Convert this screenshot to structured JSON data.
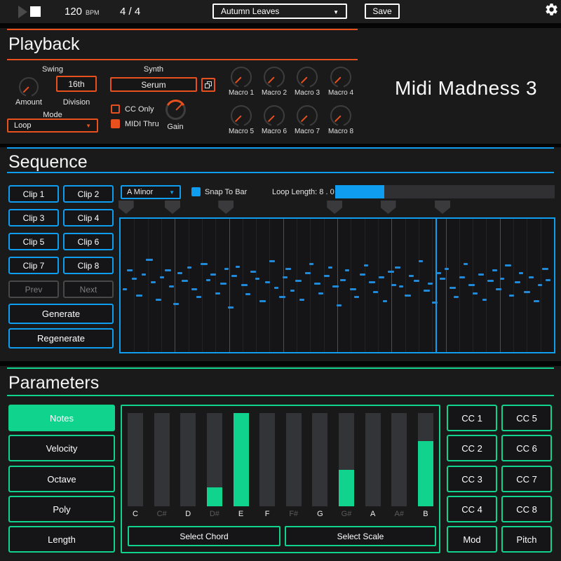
{
  "colors": {
    "orange": "#e8511e",
    "blue": "#0f9df0",
    "green": "#10d48e",
    "note_blue": "#2089d8"
  },
  "topbar": {
    "bpm_value": "120",
    "bpm_unit": "BPM",
    "time_signature": "4 / 4",
    "preset_value": "Autumn Leaves",
    "save_label": "Save"
  },
  "playback": {
    "title": "Playback",
    "swing_label": "Swing",
    "amount_label": "Amount",
    "division_value": "16th",
    "division_label": "Division",
    "synth_label": "Synth",
    "synth_value": "Serum",
    "cc_only_label": "CC Only",
    "midi_thru_label": "MIDI Thru",
    "gain_label": "Gain",
    "mode_label": "Mode",
    "mode_value": "Loop",
    "logo": "Midi Madness 3",
    "macros": [
      "Macro 1",
      "Macro 2",
      "Macro 3",
      "Macro 4",
      "Macro 5",
      "Macro 6",
      "Macro 7",
      "Macro 8"
    ]
  },
  "sequence": {
    "title": "Sequence",
    "clips": [
      "Clip 1",
      "Clip 2",
      "Clip 3",
      "Clip 4",
      "Clip 5",
      "Clip 6",
      "Clip 7",
      "Clip 8"
    ],
    "prev_label": "Prev",
    "next_label": "Next",
    "generate_label": "Generate",
    "regenerate_label": "Regenerate",
    "key_value": "A Minor",
    "snap_label": "Snap To Bar",
    "loop_length_label": "Loop Length: 8 . 0",
    "loop_fill_pct": 22.4,
    "bars": 8,
    "beats_per_bar": 4,
    "marker_positions_pct": [
      1.4,
      12.1,
      24.4,
      49.4,
      61.7,
      74.2
    ],
    "playhead_pct": 72.6,
    "notes": [
      [
        0.5,
        52,
        6
      ],
      [
        1.5,
        38,
        8
      ],
      [
        2.6,
        44,
        7
      ],
      [
        3.6,
        57,
        9
      ],
      [
        4.8,
        41,
        6
      ],
      [
        5.9,
        30,
        10
      ],
      [
        6.9,
        47,
        7
      ],
      [
        8.1,
        60,
        8
      ],
      [
        9.1,
        43,
        6
      ],
      [
        10.2,
        38,
        9
      ],
      [
        11.2,
        50,
        7
      ],
      [
        12.2,
        63,
        8
      ],
      [
        13.1,
        40,
        7
      ],
      [
        14.1,
        46,
        9
      ],
      [
        15.3,
        36,
        6
      ],
      [
        16.3,
        52,
        8
      ],
      [
        17.5,
        58,
        7
      ],
      [
        18.5,
        33,
        10
      ],
      [
        19.7,
        45,
        6
      ],
      [
        20.7,
        41,
        8
      ],
      [
        21.9,
        55,
        7
      ],
      [
        22.9,
        48,
        9
      ],
      [
        23.9,
        37,
        6
      ],
      [
        24.7,
        66,
        8
      ],
      [
        25.6,
        42,
        8
      ],
      [
        26.6,
        35,
        6
      ],
      [
        27.8,
        49,
        9
      ],
      [
        28.8,
        56,
        7
      ],
      [
        30.0,
        39,
        8
      ],
      [
        31.1,
        44,
        6
      ],
      [
        32.1,
        61,
        9
      ],
      [
        33.3,
        47,
        7
      ],
      [
        34.3,
        31,
        8
      ],
      [
        35.5,
        51,
        6
      ],
      [
        36.5,
        58,
        9
      ],
      [
        37.3,
        43,
        7
      ],
      [
        38.1,
        37,
        8
      ],
      [
        39.1,
        53,
        6
      ],
      [
        40.3,
        46,
        9
      ],
      [
        41.3,
        60,
        7
      ],
      [
        42.5,
        40,
        8
      ],
      [
        43.5,
        33,
        6
      ],
      [
        44.7,
        48,
        9
      ],
      [
        45.7,
        55,
        7
      ],
      [
        46.9,
        42,
        8
      ],
      [
        47.9,
        36,
        6
      ],
      [
        48.9,
        50,
        9
      ],
      [
        49.9,
        64,
        7
      ],
      [
        50.7,
        45,
        8
      ],
      [
        51.7,
        38,
        6
      ],
      [
        52.9,
        52,
        9
      ],
      [
        53.9,
        58,
        7
      ],
      [
        55.1,
        41,
        8
      ],
      [
        56.1,
        34,
        6
      ],
      [
        57.3,
        47,
        9
      ],
      [
        58.3,
        54,
        7
      ],
      [
        59.5,
        43,
        8
      ],
      [
        60.5,
        61,
        6
      ],
      [
        61.7,
        39,
        9
      ],
      [
        62.5,
        49,
        7
      ],
      [
        63.3,
        36,
        8
      ],
      [
        64.3,
        50,
        6
      ],
      [
        65.5,
        57,
        9
      ],
      [
        66.5,
        42,
        7
      ],
      [
        67.7,
        46,
        8
      ],
      [
        68.7,
        31,
        6
      ],
      [
        69.9,
        53,
        9
      ],
      [
        70.9,
        48,
        7
      ],
      [
        71.9,
        62,
        8
      ],
      [
        72.9,
        40,
        6
      ],
      [
        73.7,
        44,
        8
      ],
      [
        74.7,
        37,
        6
      ],
      [
        75.9,
        51,
        9
      ],
      [
        76.9,
        58,
        7
      ],
      [
        78.1,
        43,
        8
      ],
      [
        79.1,
        33,
        6
      ],
      [
        80.3,
        49,
        9
      ],
      [
        81.3,
        55,
        7
      ],
      [
        82.5,
        41,
        8
      ],
      [
        83.5,
        60,
        6
      ],
      [
        84.7,
        46,
        9
      ],
      [
        85.7,
        38,
        7
      ],
      [
        86.5,
        52,
        8
      ],
      [
        87.5,
        44,
        6
      ],
      [
        88.7,
        34,
        9
      ],
      [
        89.7,
        57,
        7
      ],
      [
        90.9,
        47,
        8
      ],
      [
        91.9,
        40,
        6
      ],
      [
        93.1,
        54,
        9
      ],
      [
        94.1,
        43,
        7
      ],
      [
        95.3,
        61,
        8
      ],
      [
        96.3,
        49,
        6
      ],
      [
        97.2,
        37,
        9
      ],
      [
        98.0,
        45,
        7
      ]
    ]
  },
  "parameters": {
    "title": "Parameters",
    "left_buttons": [
      "Notes",
      "Velocity",
      "Octave",
      "Poly",
      "Length"
    ],
    "active_left_button": "Notes",
    "chart_data": {
      "type": "bar",
      "categories": [
        "C",
        "C#",
        "D",
        "D#",
        "E",
        "F",
        "F#",
        "G",
        "G#",
        "A",
        "A#",
        "B"
      ],
      "values": [
        0,
        0,
        0,
        20,
        100,
        0,
        0,
        0,
        39,
        0,
        0,
        70
      ],
      "ylim": [
        0,
        100
      ],
      "title": "Note probability per pitch class"
    },
    "select_chord_label": "Select Chord",
    "select_scale_label": "Select Scale",
    "cc_buttons": [
      "CC 1",
      "CC 2",
      "CC 3",
      "CC 4",
      "CC 5",
      "CC 6",
      "CC 7",
      "CC 8"
    ],
    "mod_label": "Mod",
    "pitch_label": "Pitch"
  }
}
